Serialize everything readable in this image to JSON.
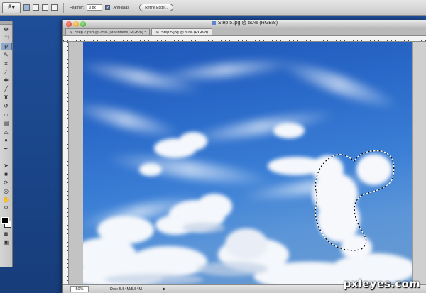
{
  "options_bar": {
    "tool_preset_icon": "lasso-icon",
    "feather_label": "Feather:",
    "feather_value": "0 px",
    "antialias_label": "Anti-alias",
    "antialias_checked": true,
    "refine_edge_label": "Refine Edge..."
  },
  "tools": [
    {
      "name": "move-tool-icon",
      "glyph": "✥"
    },
    {
      "name": "marquee-tool-icon",
      "glyph": "⬚"
    },
    {
      "name": "lasso-tool-icon",
      "glyph": "ᑭ",
      "selected": true
    },
    {
      "name": "quick-selection-tool-icon",
      "glyph": "✎"
    },
    {
      "name": "crop-tool-icon",
      "glyph": "⌗"
    },
    {
      "name": "eyedropper-tool-icon",
      "glyph": "⁄"
    },
    {
      "name": "healing-brush-tool-icon",
      "glyph": "✚"
    },
    {
      "name": "brush-tool-icon",
      "glyph": "╱"
    },
    {
      "name": "clone-stamp-tool-icon",
      "glyph": "♜"
    },
    {
      "name": "history-brush-tool-icon",
      "glyph": "↺"
    },
    {
      "name": "eraser-tool-icon",
      "glyph": "▱"
    },
    {
      "name": "gradient-tool-icon",
      "glyph": "▤"
    },
    {
      "name": "blur-tool-icon",
      "glyph": "△"
    },
    {
      "name": "dodge-tool-icon",
      "glyph": "●"
    },
    {
      "name": "pen-tool-icon",
      "glyph": "✒"
    },
    {
      "name": "type-tool-icon",
      "glyph": "T"
    },
    {
      "name": "path-selection-tool-icon",
      "glyph": "➤"
    },
    {
      "name": "shape-tool-icon",
      "glyph": "■"
    },
    {
      "name": "3d-rotate-tool-icon",
      "glyph": "⟳"
    },
    {
      "name": "3d-orbit-tool-icon",
      "glyph": "◎"
    },
    {
      "name": "hand-tool-icon",
      "glyph": "✋"
    },
    {
      "name": "zoom-tool-icon",
      "glyph": "⚲"
    }
  ],
  "swatches": {
    "foreground": "#000000",
    "background": "#ffffff"
  },
  "document": {
    "title": "Step 5.jpg @ 50% (RGB/8)",
    "tabs": [
      {
        "label": "Step 7.psd @ 25% (Mountains, RGB/8) *",
        "active": false
      },
      {
        "label": "Step 5.jpg @ 50% (RGB/8)",
        "active": true
      }
    ]
  },
  "status_bar": {
    "zoom": "50%",
    "doc_size": "Doc: 5.54M/5.54M"
  },
  "watermark": "pxleyes.com"
}
